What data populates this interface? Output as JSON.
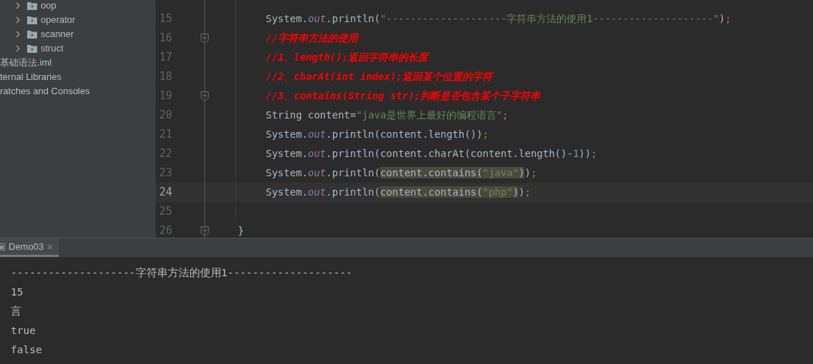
{
  "project_tree": [
    {
      "label": "oop",
      "kind": "package"
    },
    {
      "label": "operator",
      "kind": "package"
    },
    {
      "label": "scanner",
      "kind": "package"
    },
    {
      "label": "struct",
      "kind": "package"
    },
    {
      "label": "基础语法.iml",
      "kind": "file"
    },
    {
      "label": "ternal Libraries",
      "kind": "file"
    },
    {
      "label": "ratches and Consoles",
      "kind": "file"
    }
  ],
  "editor": {
    "lines": [
      {
        "number": "15",
        "kind": "statement",
        "current": false,
        "fold": false,
        "segments": [
          {
            "text": "System.",
            "kind": "plain"
          },
          {
            "text": "out",
            "kind": "static"
          },
          {
            "text": ".println(",
            "kind": "plain"
          },
          {
            "text": "\"--------------------字符串方法的使用1--------------------\"",
            "kind": "string"
          },
          {
            "text": ")",
            "kind": "plain"
          },
          {
            "text": ";",
            "kind": "punct"
          }
        ]
      },
      {
        "number": "16",
        "kind": "statement",
        "current": false,
        "fold": true,
        "segments": [
          {
            "text": "//字符串方法的使用",
            "kind": "comment"
          }
        ]
      },
      {
        "number": "17",
        "kind": "statement",
        "current": false,
        "fold": false,
        "segments": [
          {
            "text": "//1、length();返回字符串的长度",
            "kind": "comment"
          }
        ]
      },
      {
        "number": "18",
        "kind": "statement",
        "current": false,
        "fold": false,
        "segments": [
          {
            "text": "//2、charAt(int index);返回某个位置的字符",
            "kind": "comment"
          }
        ]
      },
      {
        "number": "19",
        "kind": "statement",
        "current": false,
        "fold": true,
        "segments": [
          {
            "text": "//3、contains(String str);判断是否包含某个子字符串",
            "kind": "comment"
          }
        ]
      },
      {
        "number": "20",
        "kind": "statement",
        "current": false,
        "fold": false,
        "segments": [
          {
            "text": "String content=",
            "kind": "plain"
          },
          {
            "text": "\"java是世界上最好的编程语言\"",
            "kind": "string"
          },
          {
            "text": ";",
            "kind": "punct"
          }
        ]
      },
      {
        "number": "21",
        "kind": "statement",
        "current": false,
        "fold": false,
        "segments": [
          {
            "text": "System.",
            "kind": "plain"
          },
          {
            "text": "out",
            "kind": "static"
          },
          {
            "text": ".println(content.length())",
            "kind": "plain"
          },
          {
            "text": ";",
            "kind": "punct"
          }
        ]
      },
      {
        "number": "22",
        "kind": "statement",
        "current": false,
        "fold": false,
        "segments": [
          {
            "text": "System.",
            "kind": "plain"
          },
          {
            "text": "out",
            "kind": "static"
          },
          {
            "text": ".println(content.charAt(content.length()-",
            "kind": "plain"
          },
          {
            "text": "1",
            "kind": "number"
          },
          {
            "text": "))",
            "kind": "plain"
          },
          {
            "text": ";",
            "kind": "punct"
          }
        ]
      },
      {
        "number": "23",
        "kind": "statement",
        "current": false,
        "fold": false,
        "segments": [
          {
            "text": "System.",
            "kind": "plain"
          },
          {
            "text": "out",
            "kind": "static"
          },
          {
            "text": ".println(",
            "kind": "plain"
          },
          {
            "text": "content.contains(",
            "kind": "highlight"
          },
          {
            "text": "\"java\"",
            "kind": "highlight-string"
          },
          {
            "text": ")",
            "kind": "highlight"
          },
          {
            "text": ")",
            "kind": "plain"
          },
          {
            "text": ";",
            "kind": "punct"
          }
        ]
      },
      {
        "number": "24",
        "kind": "statement",
        "current": true,
        "fold": false,
        "segments": [
          {
            "text": "System.",
            "kind": "plain"
          },
          {
            "text": "out",
            "kind": "static"
          },
          {
            "text": ".println(",
            "kind": "plain"
          },
          {
            "text": "content.contains(",
            "kind": "highlight"
          },
          {
            "text": "\"php\"",
            "kind": "highlight-string"
          },
          {
            "text": ")",
            "kind": "highlight"
          },
          {
            "text": ")",
            "kind": "plain"
          },
          {
            "text": ";",
            "kind": "punct"
          }
        ]
      },
      {
        "number": "25",
        "current": false,
        "fold": false
      },
      {
        "number": "26",
        "kind": "brace",
        "current": false,
        "fold": true,
        "segments": [
          {
            "text": "}",
            "kind": "plain"
          }
        ]
      }
    ]
  },
  "run_panel": {
    "tabs": [
      {
        "label": "Demo03",
        "selected": true
      }
    ],
    "output": [
      "--------------------字符串方法的使用1--------------------",
      "15",
      "言",
      "true",
      "false"
    ]
  }
}
